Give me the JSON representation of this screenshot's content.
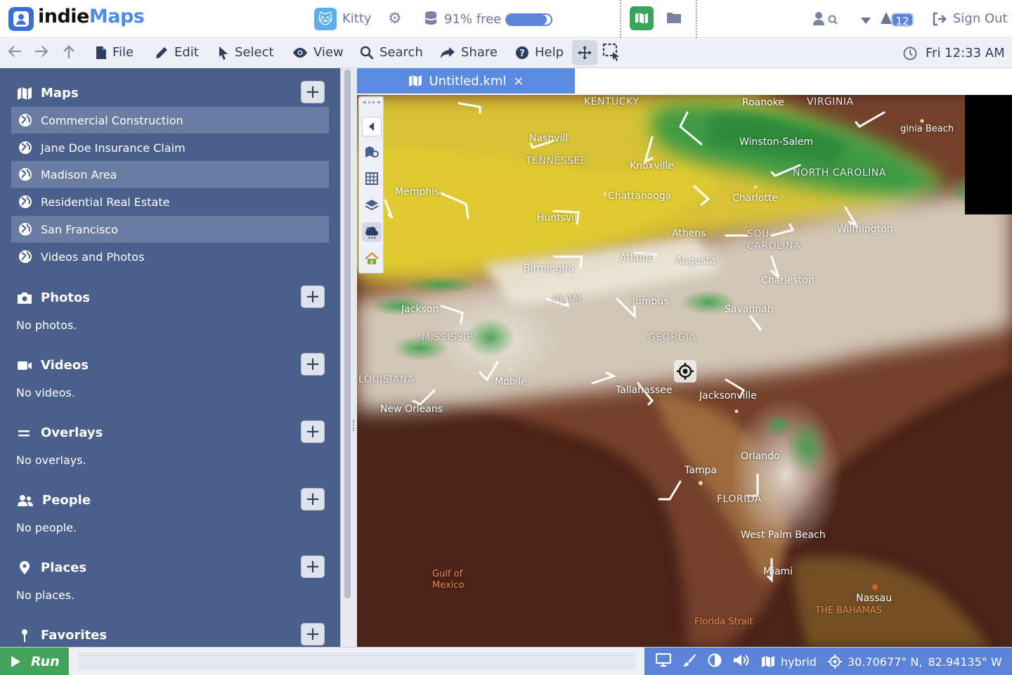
{
  "app": {
    "logo_part1": "indie",
    "logo_part2": "Maps"
  },
  "topbar": {
    "user_name": "Kitty",
    "storage_free": "91% free",
    "storage_used_fraction": 0.91,
    "notifications_count": "12",
    "sign_out_label": "Sign Out"
  },
  "menu": {
    "file": "File",
    "edit": "Edit",
    "select": "Select",
    "view": "View",
    "search": "Search",
    "share": "Share",
    "help": "Help",
    "clock": "Fri 12:33 AM"
  },
  "sidebar": {
    "maps": {
      "title": "Maps",
      "items": [
        {
          "label": "Commercial Construction",
          "shaded": true
        },
        {
          "label": "Jane Doe Insurance Claim",
          "shaded": false
        },
        {
          "label": "Madison Area",
          "shaded": true
        },
        {
          "label": "Residential Real Estate",
          "shaded": false
        },
        {
          "label": "San Francisco",
          "shaded": true
        },
        {
          "label": "Videos and Photos",
          "shaded": false
        }
      ]
    },
    "photos": {
      "title": "Photos",
      "empty": "No photos."
    },
    "videos": {
      "title": "Videos",
      "empty": "No videos."
    },
    "overlays": {
      "title": "Overlays",
      "empty": "No overlays."
    },
    "people": {
      "title": "People",
      "empty": "No people."
    },
    "places": {
      "title": "Places",
      "empty": "No places."
    },
    "favorites": {
      "title": "Favorites"
    }
  },
  "document": {
    "tab_title": "Untitled.kml",
    "close_glyph": "×"
  },
  "map_labels": {
    "kentucky": "KENTUCKY",
    "virginia": "VIRGINIA",
    "roanoke": "Roanoke",
    "virginia_beach": "ginia Beach",
    "nashville": "Nashvill",
    "tennessee": "TENNESSEE",
    "knoxville": "Knoxville",
    "winston_salem": "Winston-Salem",
    "north_carolina": "NORTH CAROLINA",
    "memphis": "Memphis",
    "chattanooga": "Chattanooga",
    "charlotte": "Charlotte",
    "huntsville": "Huntsvil",
    "athens": "Athens",
    "south_carolina_1": "SOU",
    "south_carolina_2": "CAROLINA",
    "wilmington": "Wilmington",
    "birmingham": "Birmingha",
    "atlanta": "Atlanta",
    "augusta": "Augusta",
    "charleston": "Charleston",
    "jackson": "Jackson",
    "columbus": "lumbus",
    "savannah": "Savannah",
    "alabama": "ALAM",
    "mississippi": "MISSISSIP",
    "georgia": "GEORGIA",
    "louisiana": "LOUISIANA",
    "mobile": "Mobile",
    "tallahassee": "Tallahassee",
    "jacksonville": "Jacksonville",
    "new_orleans": "New Orleans",
    "orlando": "Orlando",
    "tampa": "Tampa",
    "florida": "FLORIDA",
    "west_palm_beach": "West Palm Beach",
    "gulf_of_mexico_1": "Gulf of",
    "gulf_of_mexico_2": "Mexico",
    "miami": "Miami",
    "nassau": "Nassau",
    "bahamas": "THE BAHAMAS",
    "florida_strait": "Florida Strait"
  },
  "bottom": {
    "run_label": "Run",
    "map_type": "hybrid",
    "latitude": "30.70677° N,",
    "longitude": "82.94135° W"
  },
  "colors": {
    "accent": "#5b84d9",
    "sidebar": "#4a5f8c",
    "run": "#43a35b",
    "brand_green": "#37a55a"
  },
  "icons": [
    "user-badge-icon",
    "cat-icon",
    "gear-icon",
    "database-icon",
    "map-icon",
    "folder-icon",
    "user-search-icon",
    "caret-down-icon",
    "warning-icon",
    "sign-out-icon",
    "back-icon",
    "forward-icon",
    "up-icon",
    "file-icon",
    "pencil-icon",
    "cursor-icon",
    "eye-icon",
    "search-icon",
    "share-icon",
    "help-icon",
    "move-icon",
    "select-area-icon",
    "clock-icon",
    "globe-icon",
    "camera-icon",
    "video-icon",
    "equals-icon",
    "people-icon",
    "pin-icon",
    "monitor-icon",
    "brush-icon",
    "contrast-icon",
    "volume-icon",
    "crosshair-icon",
    "play-icon"
  ]
}
